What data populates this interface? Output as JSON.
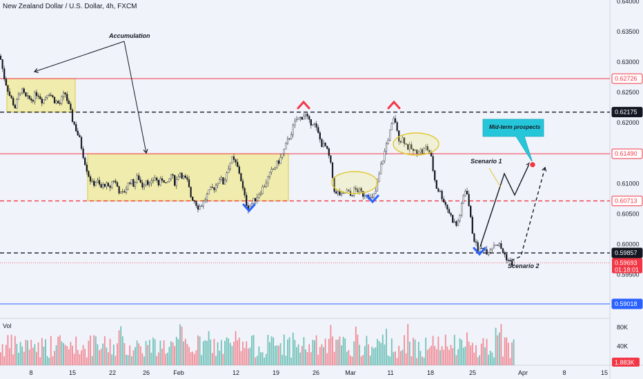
{
  "chart_data": {
    "type": "candlestick",
    "title": "New Zealand Dollar / U.S. Dollar, 4h, FXCM",
    "ylim": [
      0.5878,
      0.6402
    ],
    "y_ticks": [
      "0.64000",
      "0.63500",
      "0.63000",
      "0.62500",
      "0.62000",
      "0.61000",
      "0.60500",
      "0.60000",
      "0.59500"
    ],
    "x_ticks": [
      "8",
      "15",
      "22",
      "26",
      "Feb",
      "12",
      "19",
      "26",
      "Mar",
      "11",
      "18",
      "25",
      "Apr",
      "8",
      "15"
    ],
    "price_levels": [
      {
        "label": "0.62726",
        "value": 0.62726,
        "color": "#f23645",
        "style": "solid"
      },
      {
        "label": "0.62175",
        "value": 0.62175,
        "color": "#131722",
        "style": "dashed"
      },
      {
        "label": "0.61490",
        "value": 0.6149,
        "color": "#f23645",
        "style": "solid"
      },
      {
        "label": "0.60713",
        "value": 0.60713,
        "color": "#f23645",
        "style": "dashed"
      },
      {
        "label": "0.59857",
        "value": 0.59857,
        "color": "#131722",
        "style": "dashed"
      },
      {
        "label": "0.59018",
        "value": 0.59018,
        "color": "#2962ff",
        "style": "solid"
      }
    ],
    "current_price": {
      "label": "0.59693",
      "value": 0.59693,
      "countdown": "01:18:01",
      "color": "#f23645"
    },
    "annotations": {
      "accumulation": "Accumulation",
      "mid_term": "Mid-term prospects",
      "scenario1": "Scenario 1",
      "scenario2": "Scenario 2"
    },
    "accumulation_zones": [
      {
        "x_start": "Jan 5",
        "x_end": "Jan 16",
        "y_low": 0.62175,
        "y_high": 0.62726
      },
      {
        "x_start": "Jan 19",
        "x_end": "Feb 22",
        "y_low": 0.60713,
        "y_high": 0.6149
      }
    ],
    "price_path": [
      [
        0,
        0.631
      ],
      [
        6,
        0.6275
      ],
      [
        14,
        0.6245
      ],
      [
        22,
        0.6225
      ],
      [
        30,
        0.6255
      ],
      [
        38,
        0.624
      ],
      [
        46,
        0.6238
      ],
      [
        54,
        0.625
      ],
      [
        62,
        0.6235
      ],
      [
        70,
        0.6252
      ],
      [
        78,
        0.6238
      ],
      [
        86,
        0.623
      ],
      [
        94,
        0.625
      ],
      [
        100,
        0.6226
      ],
      [
        105,
        0.6205
      ],
      [
        110,
        0.619
      ],
      [
        116,
        0.617
      ],
      [
        122,
        0.614
      ],
      [
        128,
        0.6115
      ],
      [
        134,
        0.6098
      ],
      [
        140,
        0.6105
      ],
      [
        146,
        0.6092
      ],
      [
        152,
        0.61
      ],
      [
        158,
        0.609
      ],
      [
        164,
        0.6108
      ],
      [
        170,
        0.6095
      ],
      [
        176,
        0.608
      ],
      [
        182,
        0.609
      ],
      [
        188,
        0.6105
      ],
      [
        194,
        0.6098
      ],
      [
        200,
        0.6112
      ],
      [
        206,
        0.6096
      ],
      [
        212,
        0.6108
      ],
      [
        218,
        0.6095
      ],
      [
        224,
        0.6112
      ],
      [
        230,
        0.6098
      ],
      [
        236,
        0.611
      ],
      [
        242,
        0.6095
      ],
      [
        248,
        0.6115
      ],
      [
        254,
        0.61
      ],
      [
        260,
        0.612
      ],
      [
        266,
        0.611
      ],
      [
        272,
        0.6102
      ],
      [
        276,
        0.608
      ],
      [
        282,
        0.6072
      ],
      [
        288,
        0.606
      ],
      [
        294,
        0.6068
      ],
      [
        300,
        0.608
      ],
      [
        306,
        0.609
      ],
      [
        312,
        0.6095
      ],
      [
        318,
        0.611
      ],
      [
        324,
        0.61
      ],
      [
        330,
        0.6125
      ],
      [
        336,
        0.614
      ],
      [
        342,
        0.6132
      ],
      [
        348,
        0.6115
      ],
      [
        352,
        0.609
      ],
      [
        356,
        0.607
      ],
      [
        360,
        0.606
      ],
      [
        364,
        0.6065
      ],
      [
        370,
        0.6075
      ],
      [
        376,
        0.6085
      ],
      [
        382,
        0.6095
      ],
      [
        388,
        0.6108
      ],
      [
        394,
        0.612
      ],
      [
        400,
        0.613
      ],
      [
        406,
        0.614
      ],
      [
        412,
        0.6155
      ],
      [
        418,
        0.6172
      ],
      [
        424,
        0.619
      ],
      [
        430,
        0.6205
      ],
      [
        436,
        0.6208
      ],
      [
        442,
        0.6215
      ],
      [
        448,
        0.62
      ],
      [
        454,
        0.6202
      ],
      [
        460,
        0.6185
      ],
      [
        466,
        0.6165
      ],
      [
        472,
        0.616
      ],
      [
        478,
        0.614
      ],
      [
        482,
        0.611
      ],
      [
        486,
        0.608
      ],
      [
        490,
        0.6085
      ],
      [
        496,
        0.6078
      ],
      [
        502,
        0.6088
      ],
      [
        508,
        0.608
      ],
      [
        514,
        0.609
      ],
      [
        520,
        0.6088
      ],
      [
        526,
        0.6082
      ],
      [
        532,
        0.6085
      ],
      [
        538,
        0.6072
      ],
      [
        544,
        0.6085
      ],
      [
        548,
        0.6105
      ],
      [
        552,
        0.6128
      ],
      [
        556,
        0.6145
      ],
      [
        560,
        0.6165
      ],
      [
        564,
        0.618
      ],
      [
        568,
        0.6195
      ],
      [
        572,
        0.621
      ],
      [
        576,
        0.618
      ],
      [
        580,
        0.617
      ],
      [
        584,
        0.6175
      ],
      [
        590,
        0.616
      ],
      [
        596,
        0.6158
      ],
      [
        600,
        0.615
      ],
      [
        606,
        0.6156
      ],
      [
        612,
        0.6152
      ],
      [
        618,
        0.616
      ],
      [
        624,
        0.6148
      ],
      [
        628,
        0.612
      ],
      [
        632,
        0.6095
      ],
      [
        638,
        0.6085
      ],
      [
        644,
        0.607
      ],
      [
        650,
        0.6055
      ],
      [
        656,
        0.604
      ],
      [
        662,
        0.603
      ],
      [
        668,
        0.6055
      ],
      [
        672,
        0.608
      ],
      [
        676,
        0.6095
      ],
      [
        680,
        0.606
      ],
      [
        684,
        0.6025
      ],
      [
        688,
        0.6005
      ],
      [
        692,
        0.5992
      ],
      [
        696,
        0.599
      ],
      [
        700,
        0.5995
      ],
      [
        706,
        0.5988
      ],
      [
        712,
        0.5995
      ],
      [
        718,
        0.6002
      ],
      [
        724,
        0.5998
      ],
      [
        730,
        0.5985
      ],
      [
        736,
        0.5975
      ],
      [
        740,
        0.5968
      ],
      [
        744,
        0.597
      ],
      [
        746,
        0.5969
      ]
    ],
    "volume": {
      "ylim": [
        0,
        90000
      ],
      "y_ticks": [
        "80K",
        "40K"
      ],
      "current_label": "1.883K",
      "current_value": 1883
    }
  }
}
